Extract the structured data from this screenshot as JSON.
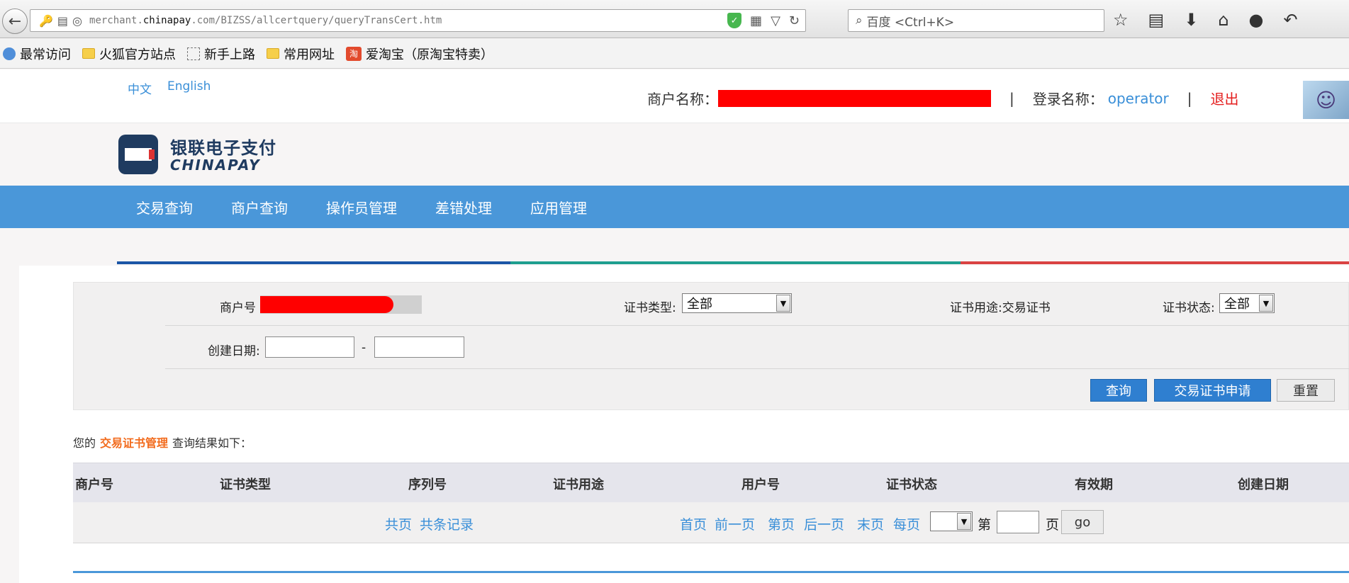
{
  "browser": {
    "url_prefix": "merchant.",
    "url_domain": "chinapay",
    "url_suffix": ".com/BIZSS/allcertquery/queryTransCert.htm",
    "search_placeholder": "百度 <Ctrl+K>"
  },
  "bookmarks": [
    "最常访问",
    "火狐官方站点",
    "新手上路",
    "常用网址",
    "爱淘宝（原淘宝特卖）"
  ],
  "header": {
    "lang_cn": "中文",
    "lang_en": "English",
    "merchant_name_label": "商户名称：",
    "login_name_label": "登录名称：",
    "login_name": "operator",
    "logout": "退出",
    "divider": "|"
  },
  "logo": {
    "cn": "银联电子支付",
    "en": "CHINAPAY"
  },
  "nav": [
    "交易查询",
    "商户查询",
    "操作员管理",
    "差错处理",
    "应用管理"
  ],
  "filter": {
    "merchant_id_label": "商户号",
    "cert_type_label": "证书类型:",
    "cert_type_value": "全部",
    "cert_usage_label": "证书用途:",
    "cert_usage_value": "交易证书",
    "cert_status_label": "证书状态:",
    "cert_status_value": "全部",
    "create_date_label": "创建日期:",
    "date_sep": "-",
    "btn_query": "查询",
    "btn_apply": "交易证书申请",
    "btn_reset": "重置"
  },
  "summary": {
    "prefix": "您的",
    "highlight": "交易证书管理",
    "suffix": "查询结果如下："
  },
  "table": {
    "columns": [
      "商户号",
      "证书类型",
      "序列号",
      "证书用途",
      "用户号",
      "证书状态",
      "有效期",
      "创建日期"
    ]
  },
  "pager": {
    "total_pages": "共页",
    "total_records": "共条记录",
    "first": "首页",
    "prev": "前一页",
    "page": "第页",
    "next": "后一页",
    "last": "末页",
    "per_page": "每页",
    "goto_prefix": "第",
    "goto_suffix": "页",
    "go": "go"
  },
  "colors": {
    "nav_blue": "#4a97d9",
    "accent_orange": "#f26b1d",
    "link_blue": "#3a8fd8"
  }
}
